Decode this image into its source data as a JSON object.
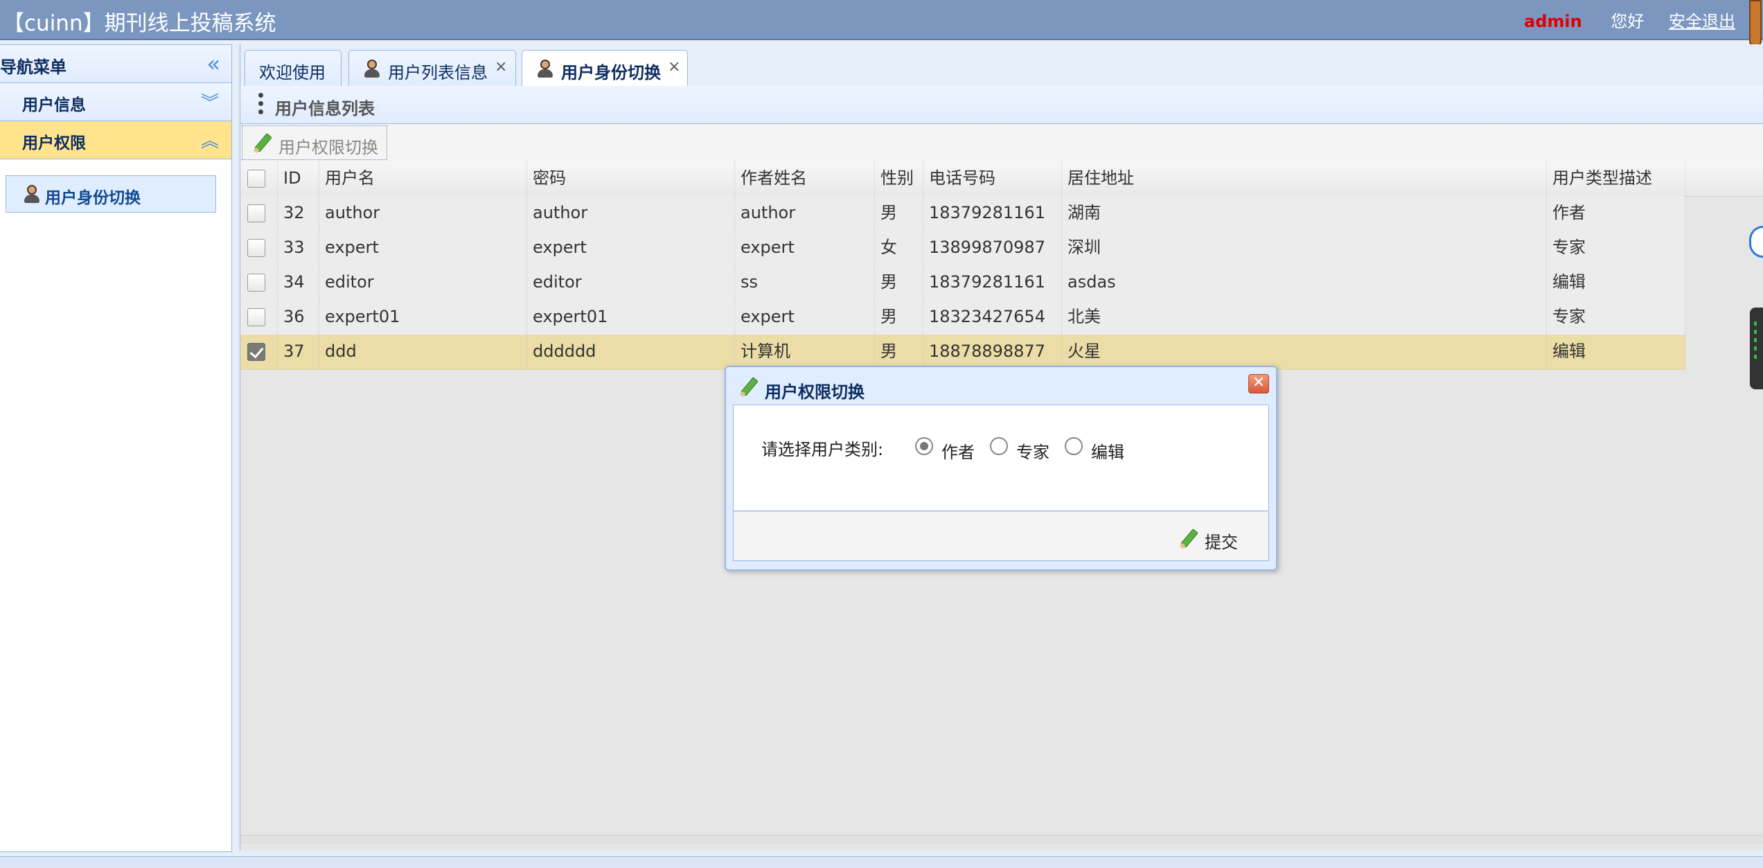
{
  "header": {
    "title": "【cuinn】期刊线上投稿系统",
    "user": "admin",
    "greeting": "您好",
    "logout": "安全退出"
  },
  "sidebar": {
    "title": "导航菜单",
    "groups": [
      {
        "label": "用户信息",
        "expanded": false
      },
      {
        "label": "用户权限",
        "expanded": true
      }
    ],
    "items": [
      {
        "label": "用户身份切换"
      }
    ]
  },
  "tabs": [
    {
      "label": "欢迎使用",
      "closable": false,
      "selected": false
    },
    {
      "label": "用户列表信息",
      "closable": true,
      "selected": false
    },
    {
      "label": "用户身份切换",
      "closable": true,
      "selected": true
    }
  ],
  "tab_close_glyph": "×",
  "panel": {
    "title": "用户信息列表",
    "toolbar_button": "用户权限切换"
  },
  "grid": {
    "columns": [
      "ID",
      "用户名",
      "密码",
      "作者姓名",
      "性别",
      "电话号码",
      "居住地址",
      "用户类型描述"
    ],
    "rows": [
      {
        "id": "32",
        "username": "author",
        "password": "author",
        "name": "author",
        "gender": "男",
        "phone": "18379281161",
        "address": "湖南",
        "type": "作者",
        "checked": false
      },
      {
        "id": "33",
        "username": "expert",
        "password": "expert",
        "name": "expert",
        "gender": "女",
        "phone": "13899870987",
        "address": "深圳",
        "type": "专家",
        "checked": false
      },
      {
        "id": "34",
        "username": "editor",
        "password": "editor",
        "name": "ss",
        "gender": "男",
        "phone": "18379281161",
        "address": "asdas",
        "type": "编辑",
        "checked": false
      },
      {
        "id": "36",
        "username": "expert01",
        "password": "expert01",
        "name": "expert",
        "gender": "男",
        "phone": "18323427654",
        "address": "北美",
        "type": "专家",
        "checked": false
      },
      {
        "id": "37",
        "username": "ddd",
        "password": "dddddd",
        "name": "计算机",
        "gender": "男",
        "phone": "18878898877",
        "address": "火星",
        "type": "编辑",
        "checked": true
      }
    ]
  },
  "dialog": {
    "title": "用户权限切换",
    "label": "请选择用户类别:",
    "options": [
      {
        "label": "作者",
        "selected": true
      },
      {
        "label": "专家",
        "selected": false
      },
      {
        "label": "编辑",
        "selected": false
      }
    ],
    "submit": "提交"
  },
  "colors": {
    "header_bg": "#7b97c0",
    "admin": "#e00000",
    "panel_border": "#95b8e7",
    "active_group": "#ffe48d",
    "selected_row": "#ecdca6"
  }
}
